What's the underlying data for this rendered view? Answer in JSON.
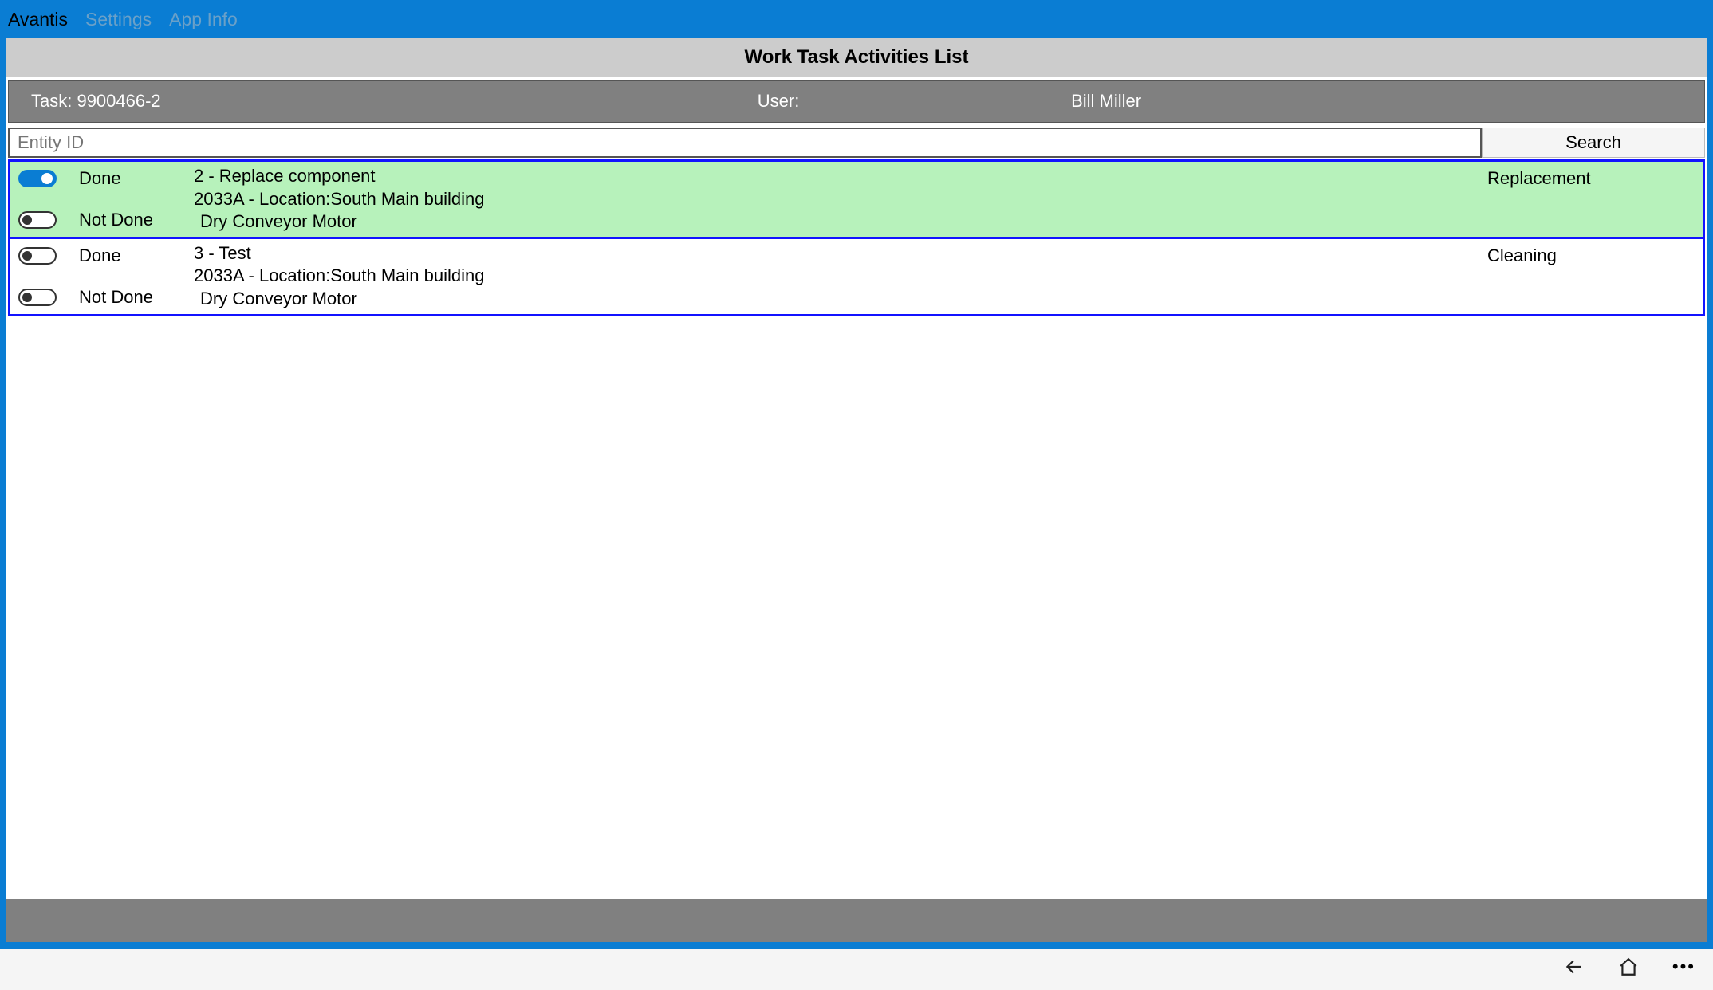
{
  "menu": {
    "items": [
      {
        "label": "Avantis",
        "active": true
      },
      {
        "label": "Settings",
        "active": false
      },
      {
        "label": "App Info",
        "active": false
      }
    ]
  },
  "title": "Work Task Activities List",
  "info": {
    "task_label": "Task: 9900466-2",
    "user_label": "User:",
    "user_name": "Bill Miller"
  },
  "search": {
    "placeholder": "Entity ID",
    "button": "Search"
  },
  "labels": {
    "done": "Done",
    "not_done": "Not Done"
  },
  "activities": [
    {
      "done_on": true,
      "not_done_on": false,
      "line1": "2 - Replace component",
      "line2": "2033A - Location:South Main building",
      "line3": "Dry Conveyor Motor",
      "category": "Replacement",
      "completed": true
    },
    {
      "done_on": false,
      "not_done_on": false,
      "line1": "3 - Test",
      "line2": "2033A - Location:South Main building",
      "line3": "Dry Conveyor Motor",
      "category": "Cleaning",
      "completed": false
    }
  ]
}
